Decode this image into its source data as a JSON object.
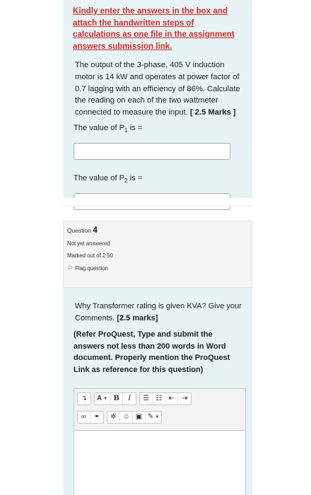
{
  "question3": {
    "instruction": "Kindly enter the answers in the box and attach the handwritten steps of calculations as one file in the assignment answers submission link.",
    "text": "The output of the 3-phase, 405 V induction motor is 14 kW and operates at power factor of 0.7 lagging with an efficiency of 86%. Calculate the reading on each of the two wattmeter connected to measure the input.",
    "marks": "[ 2.5 Marks ]",
    "p1_prompt_pre": "The value of P",
    "p1_sub": "1",
    "p1_prompt_post": " is =",
    "p1_value": "",
    "p2_prompt_pre": "The value of P",
    "p2_sub": "2",
    "p2_prompt_post": " is =",
    "p2_value": ""
  },
  "question4": {
    "label": "Question",
    "number": "4",
    "status": "Not yet answered",
    "marks": "Marked out of 2.50",
    "flag_label": "Flag question"
  },
  "question5": {
    "text": "Why Transformer rating is given KVA? Give your Comments.",
    "marks": "[2.5 marks]",
    "note": "(Refer ProQuest, Type and submit the answers not less than 200 words in Word document. Properly mention the ProQuest Link as reference for this question)"
  },
  "editor": {
    "toolbar": {
      "font_label": "A",
      "bold_label": "B",
      "italic_label": "I"
    },
    "content": ""
  },
  "colors": {
    "panel_bg": "#e7f3f5",
    "instruction": "#c9302c",
    "info_bg": "#f5f5f5"
  }
}
